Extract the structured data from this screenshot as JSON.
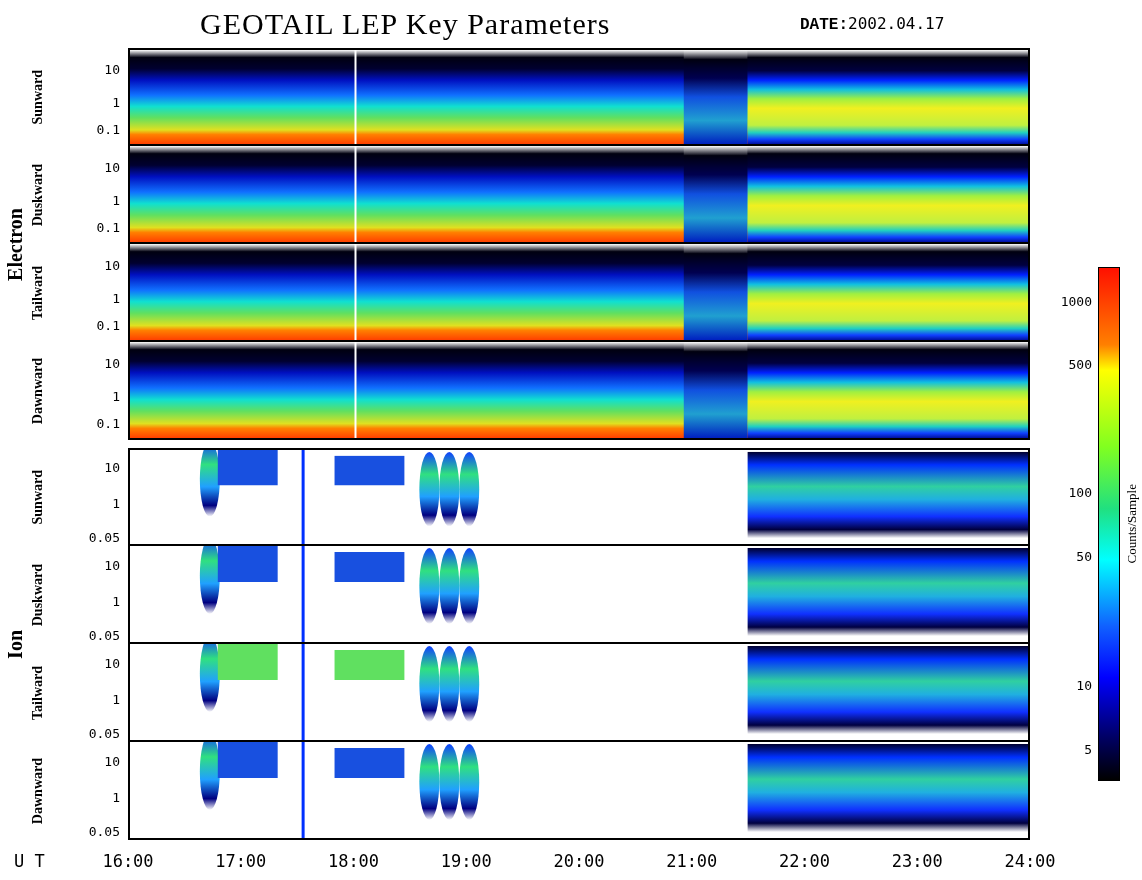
{
  "title": "GEOTAIL LEP Key Parameters",
  "date": {
    "label": "DATE:",
    "value": "2002.04.17"
  },
  "groups": [
    {
      "name": "Electron",
      "kind": "electron",
      "panels": [
        {
          "label": "Sunward",
          "yticks": [
            "10",
            "1",
            "0.1"
          ]
        },
        {
          "label": "Duskward",
          "yticks": [
            "10",
            "1",
            "0.1"
          ]
        },
        {
          "label": "Tailward",
          "yticks": [
            "10",
            "1",
            "0.1"
          ]
        },
        {
          "label": "Dawnward",
          "yticks": [
            "10",
            "1",
            "0.1"
          ]
        }
      ]
    },
    {
      "name": "Ion",
      "kind": "ion",
      "panels": [
        {
          "label": "Sunward",
          "yticks": [
            "10",
            "1",
            "0.05"
          ]
        },
        {
          "label": "Duskward",
          "yticks": [
            "10",
            "1",
            "0.05"
          ]
        },
        {
          "label": "Tailward",
          "yticks": [
            "10",
            "1",
            "0.05"
          ]
        },
        {
          "label": "Dawnward",
          "yticks": [
            "10",
            "1",
            "0.05"
          ]
        }
      ]
    }
  ],
  "x_axis": {
    "label": "U T",
    "ticks": [
      "16:00",
      "17:00",
      "18:00",
      "19:00",
      "20:00",
      "21:00",
      "22:00",
      "23:00",
      "24:00"
    ]
  },
  "colorbar": {
    "label": "Counts/Sample",
    "ticks": [
      "1000",
      "500",
      "100",
      "50",
      "10",
      "5"
    ]
  }
}
